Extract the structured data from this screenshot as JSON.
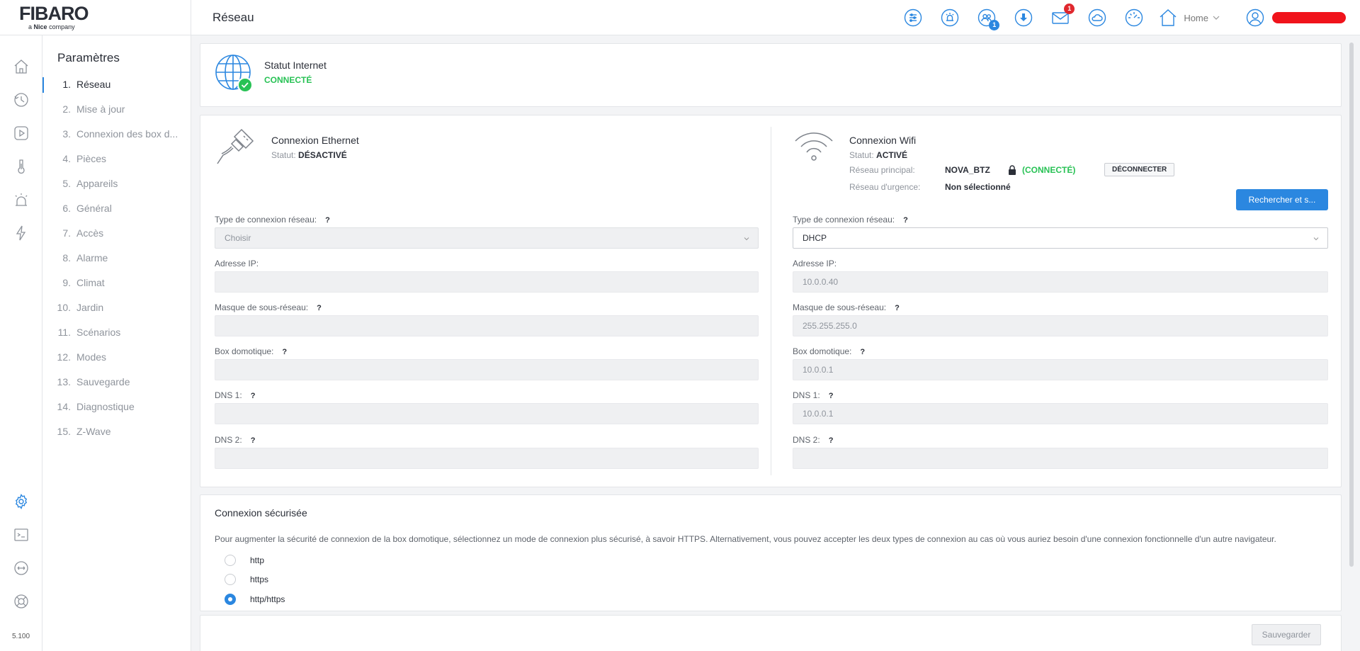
{
  "brand": {
    "name": "FIBARO",
    "sub_prefix": "a",
    "sub_bold": "Nice",
    "sub_suffix": "company"
  },
  "header": {
    "title": "Réseau",
    "home_label": "Home",
    "users_badge": "1",
    "messages_badge": "1"
  },
  "rail": {
    "version": "5.100"
  },
  "settings_nav": {
    "title": "Paramètres",
    "items": [
      {
        "num": "1.",
        "label": "Réseau"
      },
      {
        "num": "2.",
        "label": "Mise à jour"
      },
      {
        "num": "3.",
        "label": "Connexion des box d..."
      },
      {
        "num": "4.",
        "label": "Pièces"
      },
      {
        "num": "5.",
        "label": "Appareils"
      },
      {
        "num": "6.",
        "label": "Général"
      },
      {
        "num": "7.",
        "label": "Accès"
      },
      {
        "num": "8.",
        "label": "Alarme"
      },
      {
        "num": "9.",
        "label": "Climat"
      },
      {
        "num": "10.",
        "label": "Jardin"
      },
      {
        "num": "11.",
        "label": "Scénarios"
      },
      {
        "num": "12.",
        "label": "Modes"
      },
      {
        "num": "13.",
        "label": "Sauvegarde"
      },
      {
        "num": "14.",
        "label": "Diagnostique"
      },
      {
        "num": "15.",
        "label": "Z-Wave"
      }
    ]
  },
  "internet": {
    "title": "Statut Internet",
    "status": "CONNECTÉ"
  },
  "ethernet": {
    "title": "Connexion Ethernet",
    "status_label": "Statut:",
    "status_value": "DÉSACTIVÉ",
    "fields": {
      "conn_type_label": "Type de connexion réseau:",
      "conn_type_value": "Choisir",
      "ip_label": "Adresse IP:",
      "ip_value": "",
      "mask_label": "Masque de sous-réseau:",
      "mask_value": "",
      "gateway_label": "Box domotique:",
      "gateway_value": "",
      "dns1_label": "DNS 1:",
      "dns1_value": "",
      "dns2_label": "DNS 2:",
      "dns2_value": ""
    }
  },
  "wifi": {
    "title": "Connexion Wifi",
    "status_label": "Statut:",
    "status_value": "ACTIVÉ",
    "primary_label": "Réseau principal:",
    "primary_value": "NOVA_BTZ",
    "connected_tag": "(CONNECTÉ)",
    "disconnect_button": "DÉCONNECTER",
    "emergency_label": "Réseau d'urgence:",
    "emergency_value": "Non sélectionné",
    "search_button": "Rechercher et s...",
    "fields": {
      "conn_type_label": "Type de connexion réseau:",
      "conn_type_value": "DHCP",
      "ip_label": "Adresse IP:",
      "ip_value": "10.0.0.40",
      "mask_label": "Masque de sous-réseau:",
      "mask_value": "255.255.255.0",
      "gateway_label": "Box domotique:",
      "gateway_value": "10.0.0.1",
      "dns1_label": "DNS 1:",
      "dns1_value": "10.0.0.1",
      "dns2_label": "DNS 2:",
      "dns2_value": ""
    }
  },
  "help_mark": "?",
  "secure": {
    "title": "Connexion sécurisée",
    "description": "Pour augmenter la sécurité de connexion de la box domotique, sélectionnez un mode de connexion plus sécurisé, à savoir HTTPS. Alternativement, vous pouvez accepter les deux types de connexion au cas où vous auriez besoin d'une connexion fonctionnelle d'un autre navigateur.",
    "options": [
      "http",
      "https",
      "http/https"
    ],
    "selected": "http/https"
  },
  "footer": {
    "save_button": "Sauvegarder"
  },
  "colors": {
    "accent": "#2b87e0",
    "success": "#28c255",
    "badge_red": "#e0282e"
  }
}
